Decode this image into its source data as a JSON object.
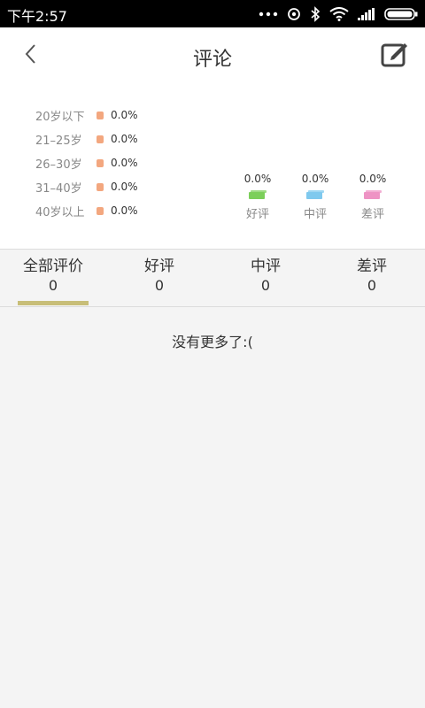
{
  "status_bar": {
    "time": "下午2:57",
    "icons": [
      "more-icon",
      "signal-circle-icon",
      "bluetooth-icon",
      "wifi-icon",
      "cell-signal-icon",
      "battery-icon"
    ]
  },
  "header": {
    "title": "评论",
    "back_icon": "chevron-left-icon",
    "compose_icon": "compose-icon"
  },
  "age_stats": [
    {
      "label": "20岁以下",
      "value": "0.0%"
    },
    {
      "label": "21–25岁",
      "value": "0.0%"
    },
    {
      "label": "26–30岁",
      "value": "0.0%"
    },
    {
      "label": "31–40岁",
      "value": "0.0%"
    },
    {
      "label": "40岁以上",
      "value": "0.0%"
    }
  ],
  "rating_stats": [
    {
      "label": "好评",
      "value": "0.0%",
      "color": "#7ccf5a"
    },
    {
      "label": "中评",
      "value": "0.0%",
      "color": "#7fc9ee"
    },
    {
      "label": "差评",
      "value": "0.0%",
      "color": "#ee93c4"
    }
  ],
  "tabs": [
    {
      "label": "全部评价",
      "count": "0",
      "active": true
    },
    {
      "label": "好评",
      "count": "0"
    },
    {
      "label": "中评",
      "count": "0"
    },
    {
      "label": "差评",
      "count": "0"
    }
  ],
  "colors": {
    "tab_indicator": "#c8be78",
    "age_dot": "#f3a77f"
  },
  "empty_message": "没有更多了:("
}
